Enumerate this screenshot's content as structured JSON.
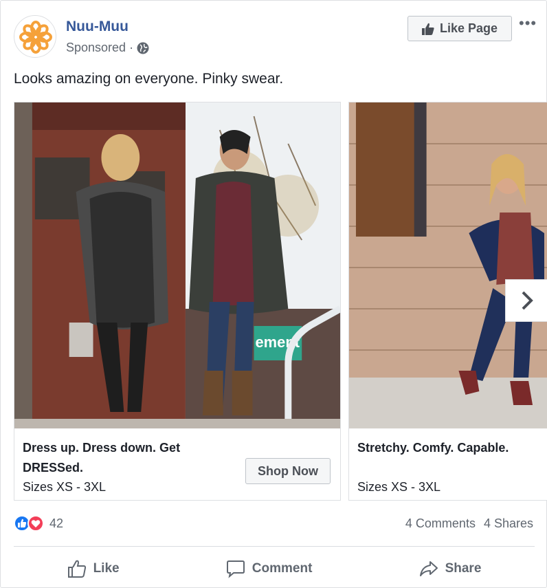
{
  "post": {
    "page_name": "Nuu-Muu",
    "sponsored_label": "Sponsored",
    "dot": "·",
    "like_page_label": "Like Page",
    "more_label": "•••",
    "text": "Looks amazing on everyone. Pinky swear."
  },
  "carousel": [
    {
      "title": "Dress up. Dress down. Get DRESSed.",
      "subtitle": "Sizes XS - 3XL",
      "cta": "Shop Now",
      "storefront_sign": "ement"
    },
    {
      "title": "Stretchy. Comfy. Capable.",
      "subtitle": "Sizes XS - 3XL"
    }
  ],
  "engagement": {
    "reaction_count": "42",
    "comments": "4 Comments",
    "shares": "4 Shares"
  },
  "actions": {
    "like": "Like",
    "comment": "Comment",
    "share": "Share"
  },
  "colors": {
    "link": "#365899",
    "logo_orange": "#f5a13a",
    "like_blue": "#1877f2",
    "love_red": "#f33e58"
  }
}
